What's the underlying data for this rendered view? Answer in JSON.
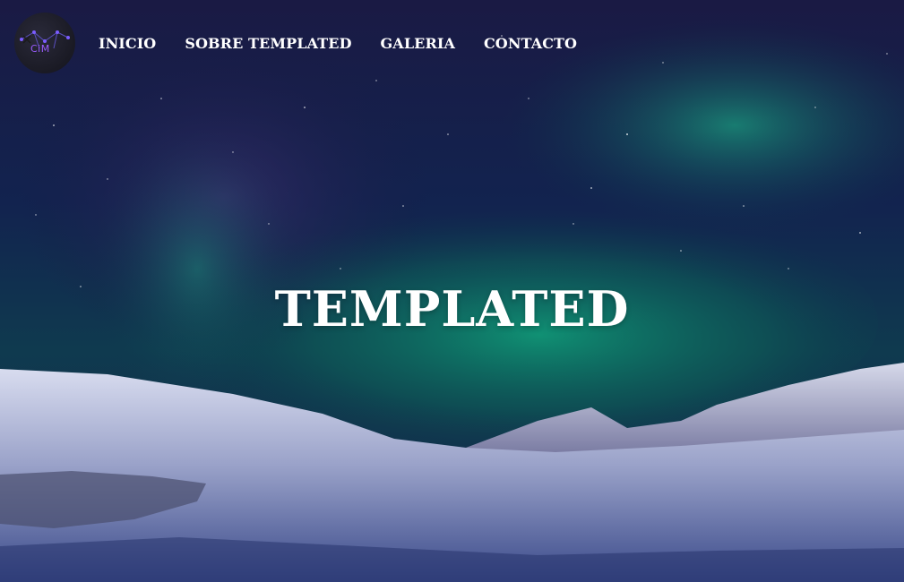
{
  "nav": {
    "logo_text": "CiM",
    "items": [
      {
        "label": "INICIO"
      },
      {
        "label": "SOBRE TEMPLATED"
      },
      {
        "label": "GALERIA"
      },
      {
        "label": "CONTACTO"
      }
    ]
  },
  "hero": {
    "title": "TEMPLATED"
  },
  "colors": {
    "sky_dark": "#1a1a44",
    "aurora_green": "#0f9a72",
    "snow": "#d8dcef",
    "text": "#ffffff",
    "logo_accent": "#9b5cff"
  }
}
